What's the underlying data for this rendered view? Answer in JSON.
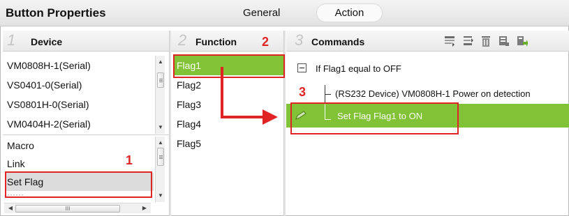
{
  "window": {
    "title": "Button Properties",
    "tabs": [
      {
        "label": "General",
        "active": false
      },
      {
        "label": "Action",
        "active": true
      }
    ]
  },
  "columns": {
    "device": {
      "number": "1",
      "label": "Device"
    },
    "function": {
      "number": "2",
      "label": "Function"
    },
    "commands": {
      "number": "3",
      "label": "Commands"
    }
  },
  "devices": [
    "VM0808H-1(Serial)",
    "VS0401-0(Serial)",
    "VS0801H-0(Serial)",
    "VM0404H-2(Serial)"
  ],
  "macros": {
    "items": [
      "Macro",
      "Link",
      "Set Flag"
    ],
    "selected": "Set Flag"
  },
  "functions": {
    "items": [
      "Flag1",
      "Flag2",
      "Flag3",
      "Flag4",
      "Flag5"
    ],
    "selected": "Flag1"
  },
  "commands_toolbar": {
    "icons": [
      "insert-command-icon",
      "move-command-icon",
      "delete-icon",
      "device-settings-icon",
      "device-export-icon"
    ]
  },
  "command_tree": {
    "if_statement": "If Flag1 equal to OFF",
    "child_1": "(RS232 Device) VM0808H-1 Power on detection",
    "child_2_selected": "Set Flag Flag1 to ON"
  },
  "annotations": {
    "markers": [
      "1",
      "2",
      "3"
    ],
    "color": "#e02424"
  },
  "colors": {
    "selection_green": "#82c236",
    "selection_gray": "#dcdcdc"
  }
}
